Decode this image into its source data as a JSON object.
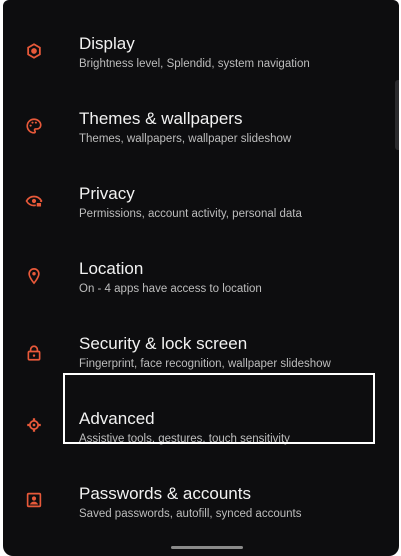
{
  "colors": {
    "background": "#0d0d0f",
    "accent": "#e8593a",
    "title": "#f2f2f2",
    "subtitle": "#bdbdbd",
    "highlight_border": "#ffffff"
  },
  "settings": {
    "items": [
      {
        "title": "Display",
        "subtitle": "Brightness level, Splendid, system navigation",
        "icon": "display-gear-icon"
      },
      {
        "title": "Themes & wallpapers",
        "subtitle": "Themes, wallpapers, wallpaper slideshow",
        "icon": "palette-icon"
      },
      {
        "title": "Privacy",
        "subtitle": "Permissions, account activity, personal data",
        "icon": "eye-lock-icon"
      },
      {
        "title": "Location",
        "subtitle": "On - 4 apps have access to location",
        "icon": "location-pin-icon"
      },
      {
        "title": "Security & lock screen",
        "subtitle": "Fingerprint, face recognition, wallpaper slideshow",
        "icon": "lock-icon"
      },
      {
        "title": "Advanced",
        "subtitle": "Assistive tools, gestures, touch sensitivity",
        "icon": "gear-icon"
      },
      {
        "title": "Passwords & accounts",
        "subtitle": "Saved passwords, autofill, synced accounts",
        "icon": "account-box-icon"
      }
    ]
  }
}
